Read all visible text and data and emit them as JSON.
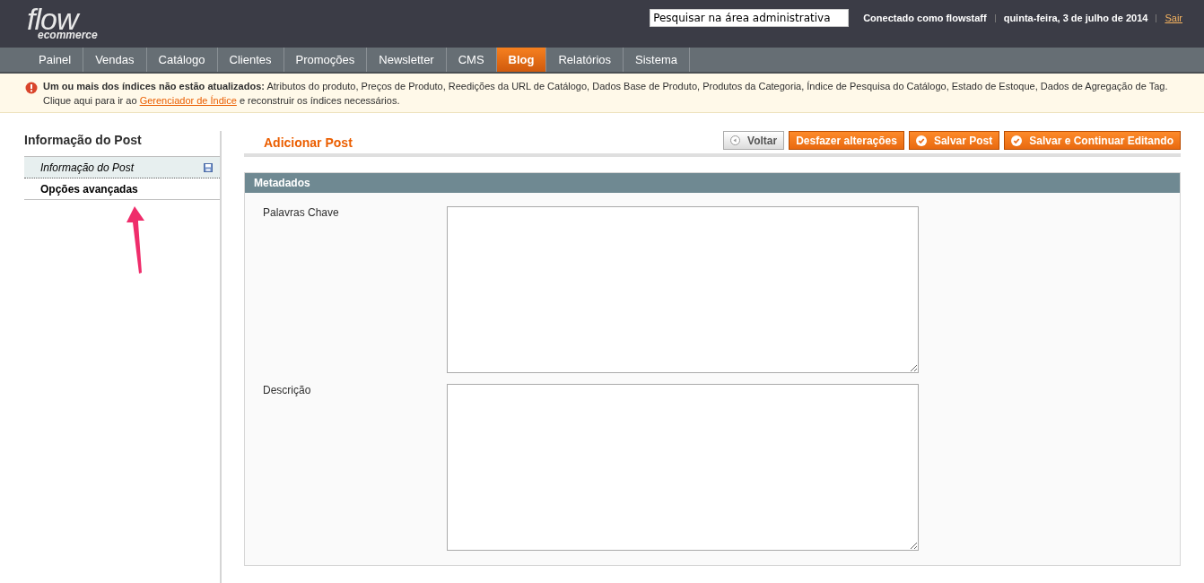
{
  "header": {
    "logo": {
      "main": "flow",
      "sub": "ecommerce"
    },
    "search": {
      "value": "Pesquisar na área administrativa"
    },
    "user": "Conectado como flowstaff",
    "date": "quinta-feira, 3 de julho de 2014",
    "logout": "Sair"
  },
  "nav": [
    {
      "label": "Painel",
      "selected": false
    },
    {
      "label": "Vendas",
      "selected": false
    },
    {
      "label": "Catálogo",
      "selected": false
    },
    {
      "label": "Clientes",
      "selected": false
    },
    {
      "label": "Promoções",
      "selected": false
    },
    {
      "label": "Newsletter",
      "selected": false
    },
    {
      "label": "CMS",
      "selected": false
    },
    {
      "label": "Blog",
      "selected": true
    },
    {
      "label": "Relatórios",
      "selected": false
    },
    {
      "label": "Sistema",
      "selected": false
    }
  ],
  "notice": {
    "bold": "Um ou mais dos índices não estão atualizados:",
    "text": "Atributos do produto, Preços de Produto, Reedições da URL de Catálogo, Dados Base de Produto, Produtos da Categoria, Índice de Pesquisa do Catálogo, Estado de Estoque, Dados de Agregação de Tag.",
    "line2_before": "Clique aqui para ir ao",
    "link": "Gerenciador de Índice",
    "line2_after": "e reconstruir os índices necessários."
  },
  "sidebar": {
    "title": "Informação do Post",
    "tabs": [
      {
        "label": "Informação do Post",
        "selected": false,
        "changed": true
      },
      {
        "label": "Opções avançadas",
        "selected": true,
        "changed": false
      }
    ]
  },
  "page_title": "Adicionar Post",
  "buttons": [
    {
      "label": "Voltar",
      "kind": "back"
    },
    {
      "label": "Desfazer alterações",
      "kind": "plain"
    },
    {
      "label": "Salvar Post",
      "kind": "save"
    },
    {
      "label": "Salvar e Continuar Editando",
      "kind": "save"
    }
  ],
  "fieldset": {
    "title": "Metadados",
    "fields": [
      {
        "label": "Palavras Chave"
      },
      {
        "label": "Descrição"
      }
    ]
  }
}
